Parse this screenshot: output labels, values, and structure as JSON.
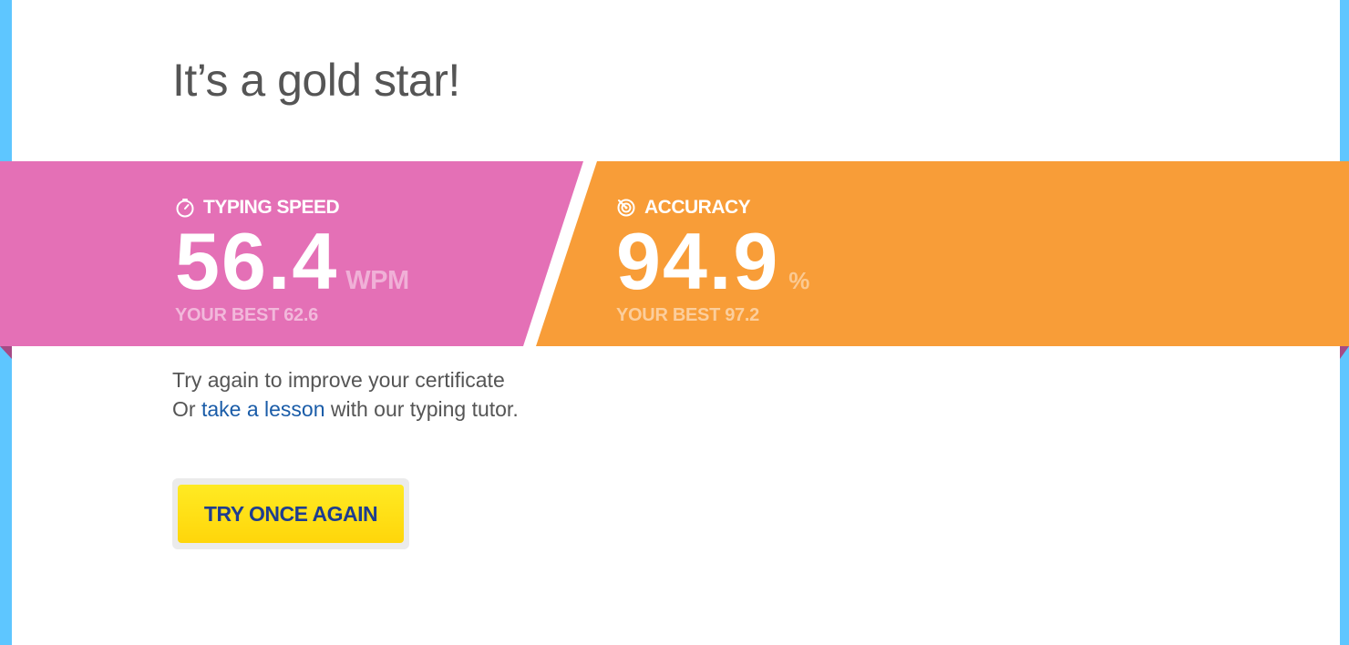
{
  "headline": "It’s a gold star!",
  "typing_speed": {
    "label": "TYPING SPEED",
    "icon": "stopwatch-icon",
    "value": "56.4",
    "unit": "WPM",
    "best": "YOUR BEST 62.6"
  },
  "accuracy": {
    "label": "ACCURACY",
    "icon": "target-icon",
    "value": "94.9",
    "unit": "%",
    "best": "YOUR BEST 97.2"
  },
  "message": {
    "line1": "Try again to improve your certificate",
    "line2_prefix": "Or ",
    "line2_link": "take a lesson",
    "line2_suffix": " with our typing tutor."
  },
  "button": {
    "label": "TRY ONCE AGAIN"
  },
  "colors": {
    "background": "#5ec6ff",
    "speed_panel": "#e470b6",
    "accuracy_panel": "#f89d38",
    "button": "#ffe414",
    "button_text": "#1e3d8f",
    "link": "#1a5ca8"
  }
}
